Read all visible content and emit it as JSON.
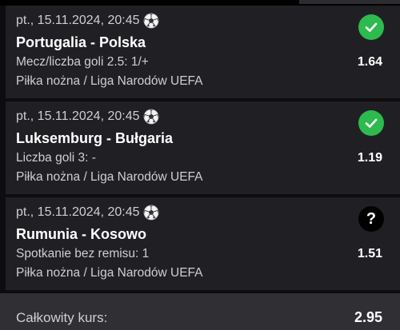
{
  "bets": [
    {
      "date": "pt., 15.11.2024, 20:45",
      "match": "Portugalia - Polska",
      "market": "Mecz/liczba goli 2.5: 1/+",
      "odds": "1.64",
      "league": "Piłka nożna / Liga Narodów UEFA",
      "status": "won",
      "status_icon": "checkmark-icon"
    },
    {
      "date": "pt., 15.11.2024, 20:45",
      "match": "Luksemburg - Bułgaria",
      "market": "Liczba goli 3: -",
      "odds": "1.19",
      "league": "Piłka nożna / Liga Narodów UEFA",
      "status": "won",
      "status_icon": "checkmark-icon"
    },
    {
      "date": "pt., 15.11.2024, 20:45",
      "match": "Rumunia - Kosowo",
      "market": "Spotkanie bez remisu: 1",
      "odds": "1.51",
      "league": "Piłka nożna / Liga Narodów UEFA",
      "status": "pending",
      "status_icon": "question-icon",
      "status_glyph": "?"
    }
  ],
  "total": {
    "label": "Całkowity kurs:",
    "value": "2.95"
  },
  "colors": {
    "won": "#2dbb4f",
    "pending": "#000000",
    "card_bg": "#202024",
    "total_bg": "#303034"
  },
  "sport_icon": "soccer-ball-icon"
}
